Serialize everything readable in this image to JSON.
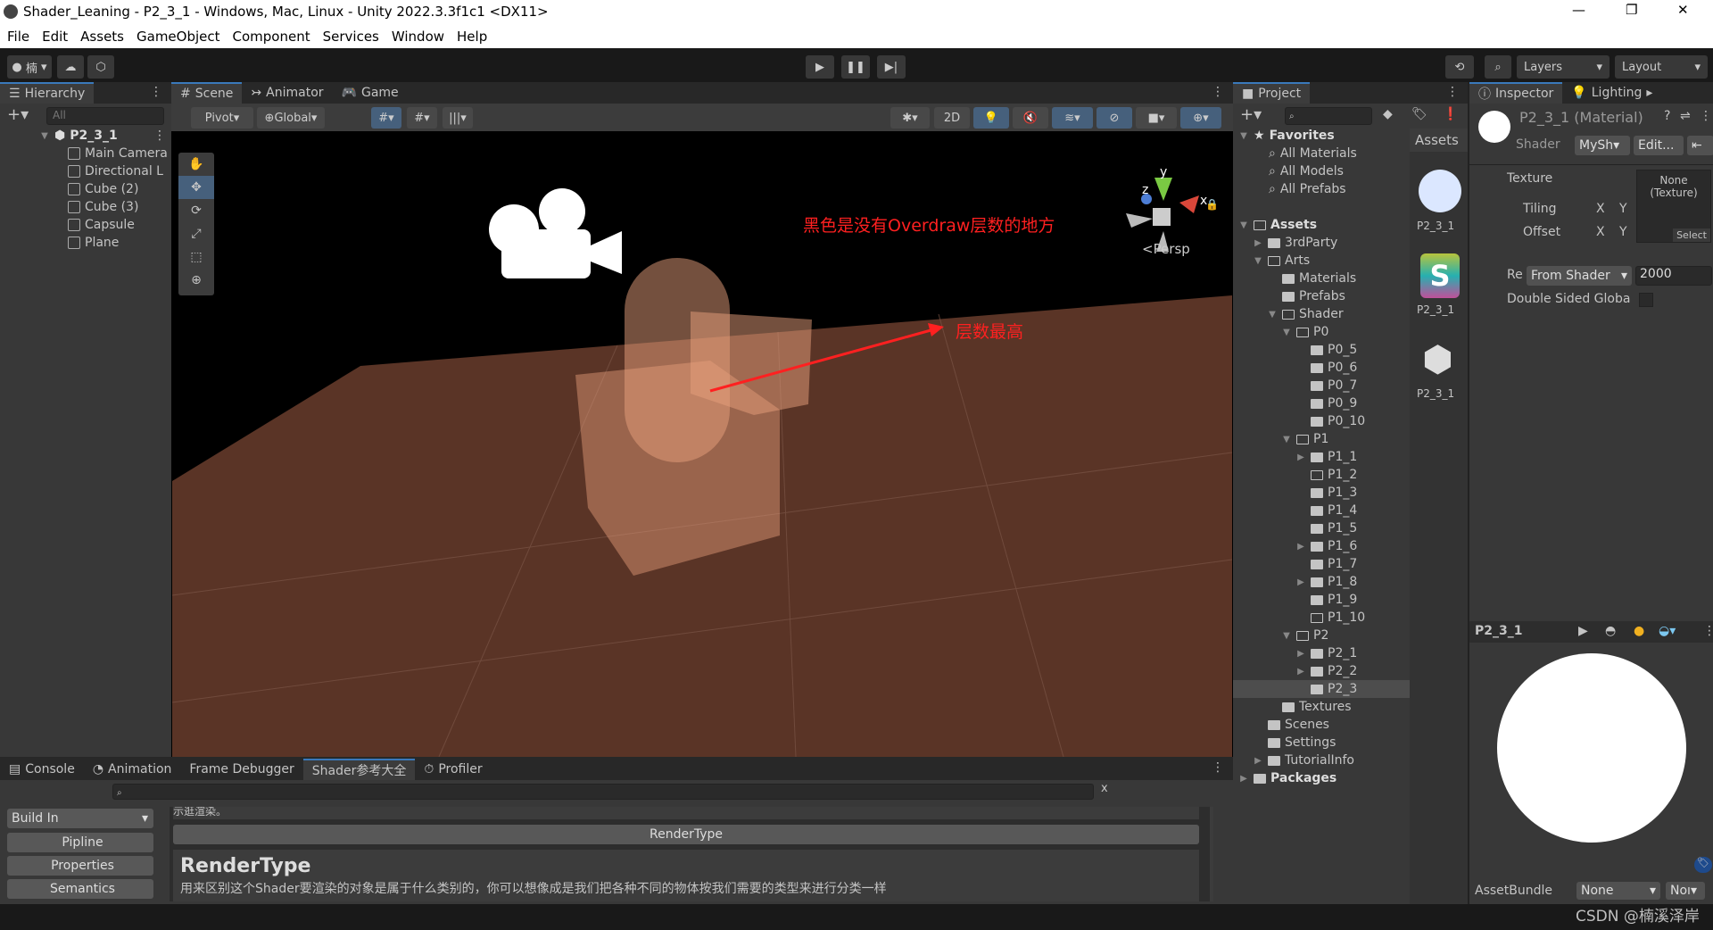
{
  "window": {
    "title": "Shader_Leaning - P2_3_1 - Windows, Mac, Linux - Unity 2022.3.3f1c1 <DX11>"
  },
  "menu": [
    "File",
    "Edit",
    "Assets",
    "GameObject",
    "Component",
    "Services",
    "Window",
    "Help"
  ],
  "toolbar": {
    "account": "楠",
    "layers": "Layers",
    "layout": "Layout"
  },
  "hierarchy": {
    "tab": "Hierarchy",
    "search_placeholder": "All",
    "scene": "P2_3_1",
    "items": [
      "Main Camera",
      "Directional L",
      "Cube (2)",
      "Cube (3)",
      "Capsule",
      "Plane"
    ]
  },
  "scene": {
    "tabs": [
      "Scene",
      "Animator",
      "Game"
    ],
    "pivot": "Pivot",
    "global": "Global",
    "mode_2d": "2D",
    "persp": "<Persp",
    "annotation_1": "黑色是没有Overdraw层数的地方",
    "annotation_2": "层数最高",
    "gizmo": {
      "x": "x",
      "y": "y",
      "z": "z"
    },
    "colors": {
      "sky": "#000000",
      "plane": "#5a3426",
      "overdraw": "#e8a07c",
      "annotation": "#ff2020"
    }
  },
  "bottom": {
    "tabs": [
      "Console",
      "Animation",
      "Frame Debugger",
      "Shader参考大全",
      "Profiler"
    ],
    "clear": "x",
    "pipeline_select": "Build In",
    "side_buttons": [
      "Pipline",
      "Properties",
      "Semantics"
    ],
    "prev_text": "示逛渲染。",
    "section_button": "RenderType",
    "heading": "RenderType",
    "body_text": "用来区别这个Shader要渲染的对象是属于什么类别的，你可以想像成是我们把各种不同的物体按我们需要的类型来进行分类一样"
  },
  "project": {
    "tab": "Project",
    "favorites": "Favorites",
    "fav_items": [
      "All Materials",
      "All Models",
      "All Prefabs"
    ],
    "tree": [
      {
        "label": "Assets",
        "depth": 0,
        "fold": "open",
        "bold": true
      },
      {
        "label": "3rdParty",
        "depth": 1,
        "fold": "closed"
      },
      {
        "label": "Arts",
        "depth": 1,
        "fold": "open"
      },
      {
        "label": "Materials",
        "depth": 2
      },
      {
        "label": "Prefabs",
        "depth": 2
      },
      {
        "label": "Shader",
        "depth": 2,
        "fold": "open"
      },
      {
        "label": "P0",
        "depth": 3,
        "fold": "open"
      },
      {
        "label": "P0_5",
        "depth": 4
      },
      {
        "label": "P0_6",
        "depth": 4
      },
      {
        "label": "P0_7",
        "depth": 4
      },
      {
        "label": "P0_9",
        "depth": 4
      },
      {
        "label": "P0_10",
        "depth": 4
      },
      {
        "label": "P1",
        "depth": 3,
        "fold": "open"
      },
      {
        "label": "P1_1",
        "depth": 4,
        "fold": "closed"
      },
      {
        "label": "P1_2",
        "depth": 4,
        "empty": true
      },
      {
        "label": "P1_3",
        "depth": 4
      },
      {
        "label": "P1_4",
        "depth": 4
      },
      {
        "label": "P1_5",
        "depth": 4
      },
      {
        "label": "P1_6",
        "depth": 4,
        "fold": "closed"
      },
      {
        "label": "P1_7",
        "depth": 4
      },
      {
        "label": "P1_8",
        "depth": 4,
        "fold": "closed"
      },
      {
        "label": "P1_9",
        "depth": 4
      },
      {
        "label": "P1_10",
        "depth": 4,
        "empty": true
      },
      {
        "label": "P2",
        "depth": 3,
        "fold": "open"
      },
      {
        "label": "P2_1",
        "depth": 4,
        "fold": "closed"
      },
      {
        "label": "P2_2",
        "depth": 4,
        "fold": "closed"
      },
      {
        "label": "P2_3",
        "depth": 4,
        "selected": true
      },
      {
        "label": "Textures",
        "depth": 2
      },
      {
        "label": "Scenes",
        "depth": 1
      },
      {
        "label": "Settings",
        "depth": 1
      },
      {
        "label": "TutorialInfo",
        "depth": 1,
        "fold": "closed"
      },
      {
        "label": "Packages",
        "depth": 0,
        "fold": "closed",
        "bold": true
      }
    ],
    "assets_header": "Assets",
    "assets": [
      "P2_3_1",
      "P2_3_1",
      "P2_3_1"
    ]
  },
  "inspector": {
    "tabs": [
      "Inspector",
      "Lighting"
    ],
    "title": "P2_3_1 (Material)",
    "shader_label": "Shader",
    "shader_value": "MySh",
    "edit": "Edit...",
    "texture_label": "Texture",
    "texture_slot": "None (Texture)",
    "select": "Select",
    "tiling": "Tiling",
    "offset": "Offset",
    "x": "X",
    "y": "Y",
    "render_queue_label": "Re",
    "render_queue_mode": "From Shader",
    "render_queue_value": "2000",
    "double_sided": "Double Sided Globa",
    "preview_title": "P2_3_1",
    "assetbundle_label": "AssetBundle",
    "assetbundle_value": "None",
    "assetbundle_variant": "Noı"
  },
  "watermark": "CSDN @楠溪泽岸"
}
